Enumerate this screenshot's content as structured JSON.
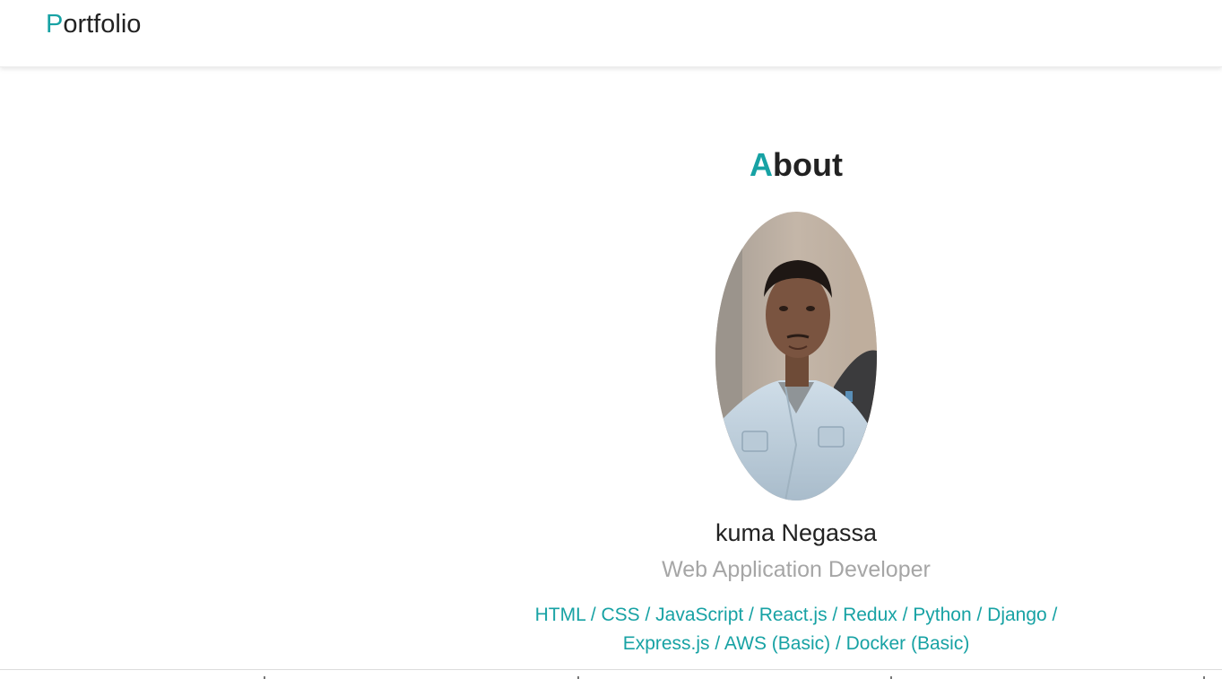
{
  "navbar": {
    "brand_initial": "P",
    "brand_rest": "ortfolio"
  },
  "about": {
    "title_initial": "A",
    "title_rest": "bout",
    "photo_alt": "Profile photo",
    "name": "kuma Negassa",
    "role": "Web Application Developer",
    "skills_line1": "HTML / CSS / JavaScript / React.js / Redux / Python / Django /",
    "skills_line2": "Express.js / AWS (Basic) / Docker (Basic)"
  },
  "colors": {
    "accent": "#17a2a4",
    "text": "#222222",
    "muted": "#a6a6a6"
  }
}
